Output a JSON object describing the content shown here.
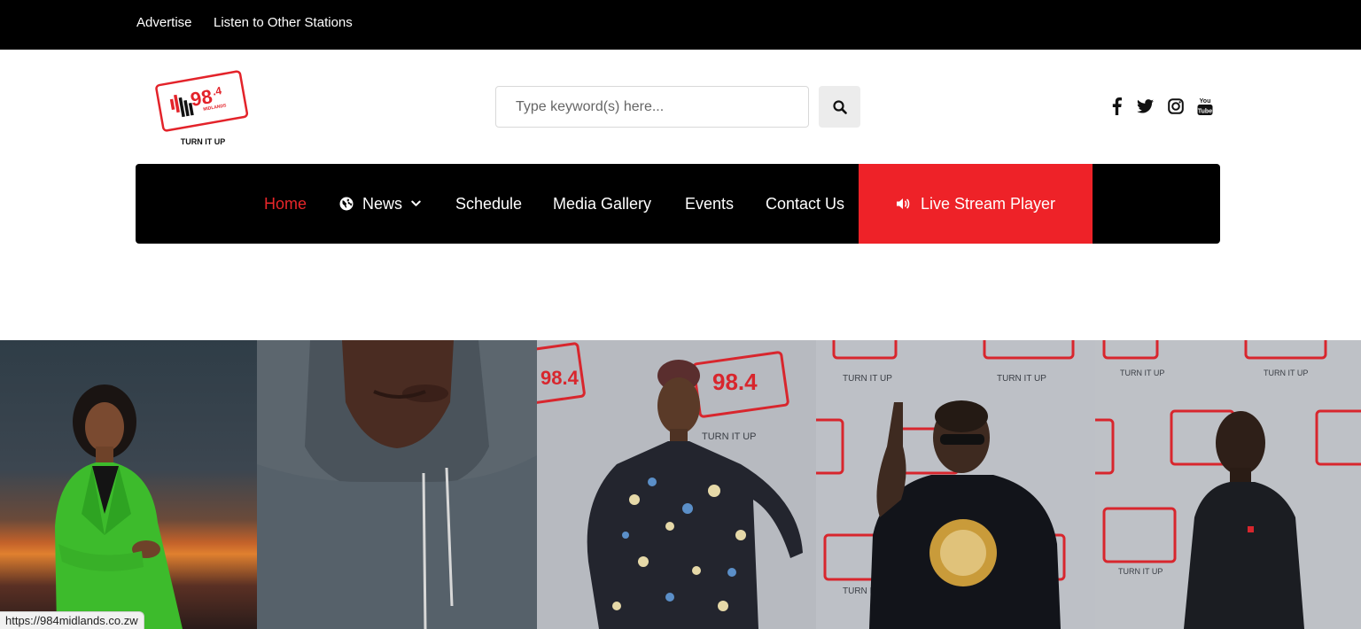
{
  "topbar": {
    "links": [
      "Advertise",
      "Listen to Other Stations"
    ]
  },
  "logo": {
    "brand_number": "98",
    "brand_decimal": ".4",
    "brand_sub": "MIDLANDS",
    "tagline": "TURN IT UP"
  },
  "search": {
    "placeholder": "Type keyword(s) here...",
    "value": ""
  },
  "social": [
    "facebook-icon",
    "twitter-icon",
    "instagram-icon",
    "youtube-icon"
  ],
  "nav": {
    "home": "Home",
    "news": "News",
    "schedule": "Schedule",
    "gallery": "Media Gallery",
    "events": "Events",
    "contact": "Contact Us",
    "live": "Live Stream Player"
  },
  "hero": {
    "backdrop_text": "TURN IT UP",
    "backdrop_logo": "98.4"
  },
  "status_url": "https://984midlands.co.zw",
  "colors": {
    "accent": "#ee2228",
    "active_nav": "#e8262a",
    "topbar": "#000000",
    "nav_bg": "#000000"
  }
}
